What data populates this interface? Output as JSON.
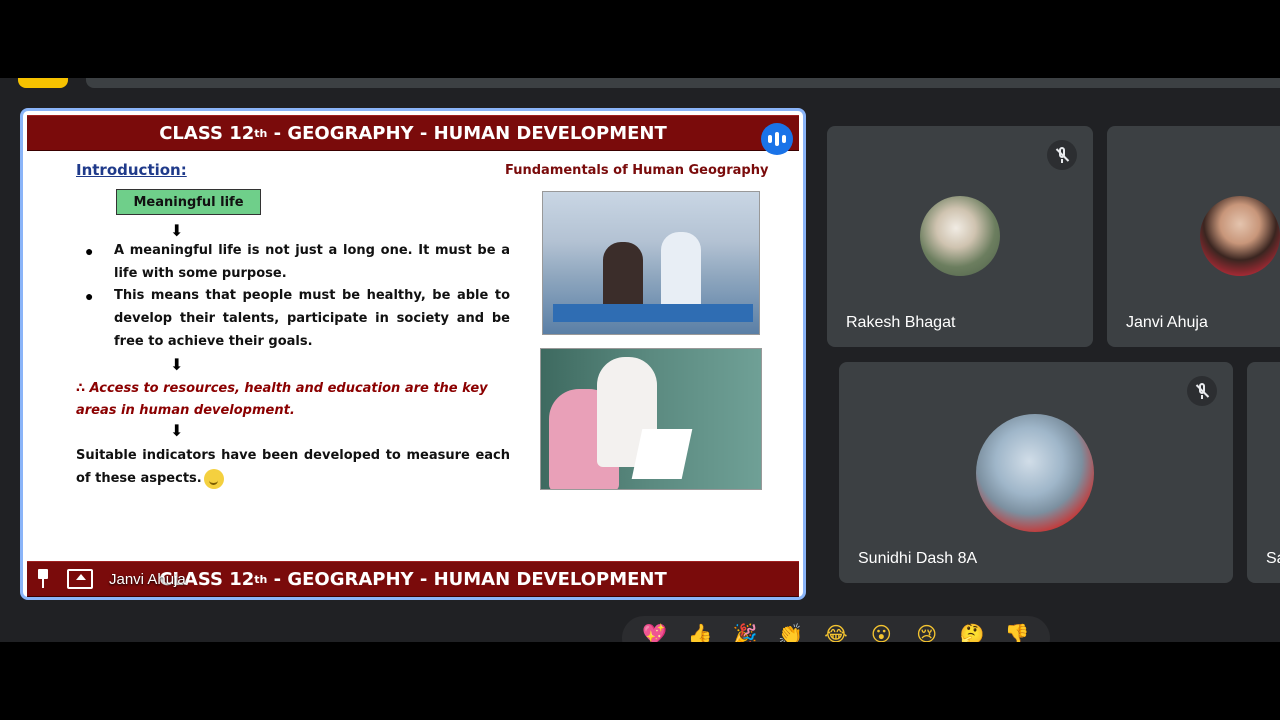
{
  "slide": {
    "title_prefix": "CLASS 12",
    "title_sup": "th",
    "title_suffix": " - GEOGRAPHY - HUMAN DEVELOPMENT",
    "intro_heading": "Introduction:",
    "book_title": "Fundamentals of Human Geography",
    "meaningful_box": "Meaningful life",
    "arrow": "⬇",
    "bullet_glyph": "●",
    "bullets": [
      "A meaningful life is not just a long one. It must be a life with some purpose.",
      "This means that people must be healthy, be able to develop their talents, participate in society and be free to achieve their goals."
    ],
    "key_areas": "∴ Access to resources, health and education are the key areas in human development.",
    "indicators": "Suitable indicators have been developed to measure each of these aspects."
  },
  "presenter": {
    "name": "Janvi Ahuja"
  },
  "participants": [
    {
      "name": "Rakesh Bhagat",
      "muted": true
    },
    {
      "name": "Janvi Ahuja",
      "muted": false
    },
    {
      "name": "Sunidhi Dash 8A",
      "muted": true
    },
    {
      "name": "Sa",
      "muted": false
    }
  ],
  "reactions": [
    "💖",
    "👍",
    "🎉",
    "👏",
    "😂",
    "😮",
    "😢",
    "🤔",
    "👎"
  ],
  "colors": {
    "accent": "#8ab4f8",
    "slide_band": "#7a0b0b",
    "highlight_box": "#6fcf8a",
    "tile_bg": "#3c4043",
    "stage_bg": "#202124"
  }
}
